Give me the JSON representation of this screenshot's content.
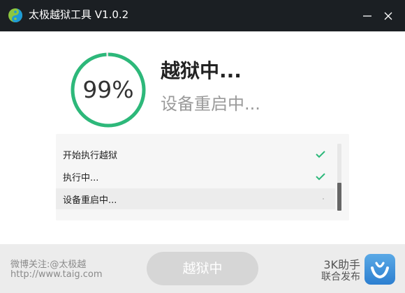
{
  "app": {
    "title": "太极越狱工具 V1.0.2",
    "logo_icon": "taig-logo-icon"
  },
  "window_controls": {
    "minimize_icon": "minimize-icon",
    "close_icon": "close-icon"
  },
  "progress": {
    "value": 0.99,
    "label": "99%",
    "color": "#2db87a"
  },
  "status": {
    "title": "越狱中...",
    "subtitle": "设备重启中..."
  },
  "steps": [
    {
      "label": "开始执行越狱",
      "state": "done",
      "icon": "check-icon"
    },
    {
      "label": "执行中...",
      "state": "done",
      "icon": "check-icon"
    },
    {
      "label": "设备重启中...",
      "state": "active",
      "icon": ""
    }
  ],
  "footer": {
    "weibo": "微博关注:@太极越",
    "url": "http://www.taig.com",
    "main_button_label": "越狱中",
    "partner_name": "3K助手",
    "partner_sub": "联合发布",
    "partner_icon": "3k-assistant-logo-icon"
  }
}
